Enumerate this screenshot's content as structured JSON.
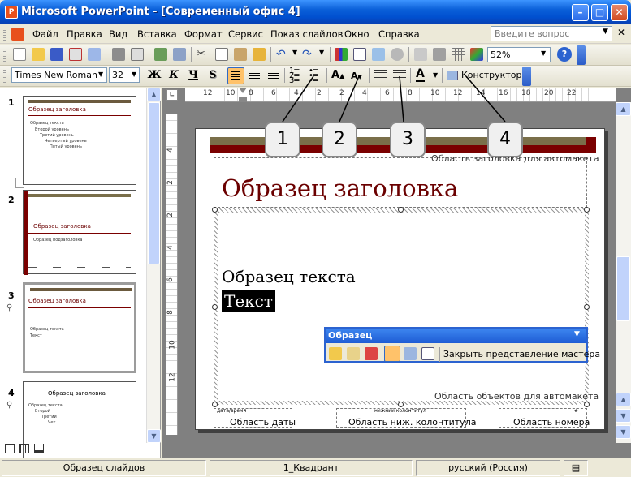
{
  "window": {
    "title": "Microsoft PowerPoint - [Современный офис 4]",
    "app_icon": "P"
  },
  "menu": {
    "items": [
      "Файл",
      "Правка",
      "Вид",
      "Вставка",
      "Формат",
      "Сервис",
      "Показ слайдов",
      "Окно",
      "Справка"
    ],
    "help_placeholder": "Введите вопрос"
  },
  "toolbar": {
    "zoom": "52%",
    "font_name": "Times New Roman",
    "font_size": "32",
    "bold": "Ж",
    "italic": "К",
    "underline": "Ч",
    "shadow": "S",
    "designer": "Конструктор"
  },
  "ruler": {
    "h_labels": [
      "12",
      "10",
      "8",
      "6",
      "4",
      "2",
      "2",
      "4",
      "6",
      "8",
      "10",
      "12",
      "14",
      "16",
      "18",
      "20",
      "22"
    ],
    "v_labels": [
      "4",
      "2",
      "2",
      "4",
      "6",
      "8",
      "10",
      "12"
    ]
  },
  "slides_panel": {
    "numbers": [
      "1",
      "2",
      "3",
      "4"
    ],
    "thumb1": {
      "title": "Образец заголовка",
      "l1": "Образец текста",
      "l2": "Второй уровень",
      "l3": "Третий уровень",
      "l4": "Четвертый уровень",
      "l5": "Пятый уровень"
    },
    "thumb2": {
      "title": "Образец заголовка",
      "sub": "Образец подзаголовка"
    },
    "thumb3": {
      "title": "Образец заголовка",
      "l1": "Образец текста",
      "l2": "Текст"
    },
    "thumb4": {
      "title": "Образец заголовка",
      "l1": "Образец текста",
      "l2": "Второй",
      "l3": "Третий",
      "l4": "Чет"
    }
  },
  "slide": {
    "title_area_label": "Область заголовка для автомакета",
    "title": "Образец заголовка",
    "body_text": "Образец текста",
    "body_selected": "Текст",
    "objects_area_label": "Область объектов для автомакета",
    "date_small": "дата/время",
    "footer_small": "нижний колонтитул",
    "number_small": "#",
    "date_area": "Область даты",
    "footer_area": "Область ниж. колонтитула",
    "number_area": "Область номера"
  },
  "callouts": [
    "1",
    "2",
    "3",
    "4"
  ],
  "float_toolbar": {
    "title": "Образец",
    "close_master": "Закрыть представление мастера"
  },
  "status": {
    "view": "Образец слайдов",
    "design": "1_Квадрант",
    "lang": "русский (Россия)"
  }
}
